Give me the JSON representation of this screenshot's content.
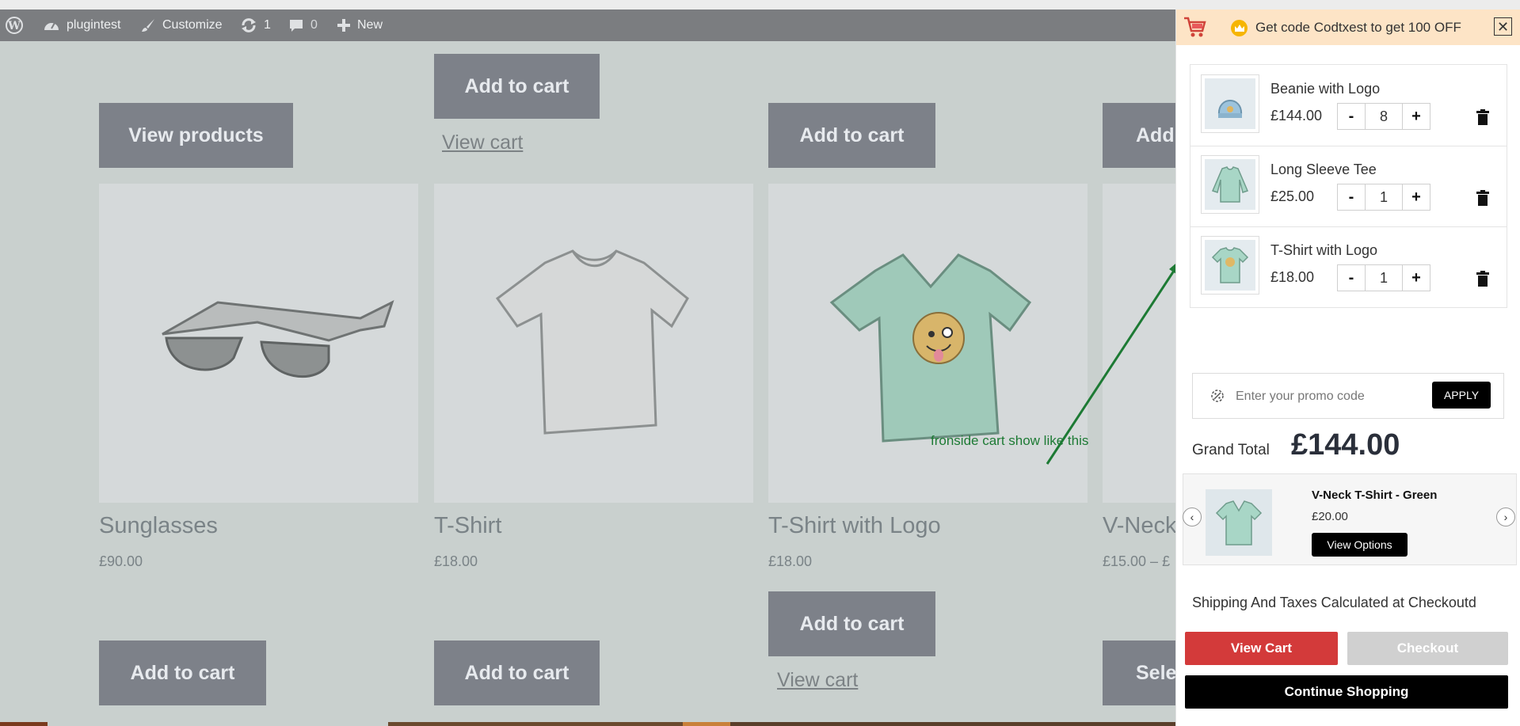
{
  "admin_bar": {
    "site_name": "plugintest",
    "customize": "Customize",
    "updates_count": "1",
    "comments_count": "0",
    "new_label": "New"
  },
  "shop": {
    "top_buttons": {
      "view_products": "View products",
      "add_to_cart": "Add to cart",
      "view_cart": "View cart"
    },
    "products": [
      {
        "name": "Sunglasses",
        "price": "£90.00",
        "button": "Add to cart"
      },
      {
        "name": "T-Shirt",
        "price": "£18.00",
        "button": "Add to cart"
      },
      {
        "name": "T-Shirt with Logo",
        "price": "£18.00",
        "button": "Add to cart",
        "link": "View cart"
      },
      {
        "name": "V-Neck",
        "price": "£15.00 – £",
        "button": "Sele"
      }
    ],
    "partial_top_button_4": "Add"
  },
  "annotation": {
    "text": "fronside cart show like this",
    "color": "#1d7a34"
  },
  "cart": {
    "notice": "Get code Codtxest to get 100 OFF",
    "close_symbol": "✕",
    "items": [
      {
        "name": "Beanie with Logo",
        "price": "£144.00",
        "qty": "8",
        "minus": "-",
        "plus": "+",
        "icon": "beanie-thumbnail"
      },
      {
        "name": "Long Sleeve Tee",
        "price": "£25.00",
        "qty": "1",
        "minus": "-",
        "plus": "+",
        "icon": "long-sleeve-thumbnail"
      },
      {
        "name": "T-Shirt with Logo",
        "price": "£18.00",
        "qty": "1",
        "minus": "-",
        "plus": "+",
        "icon": "tshirt-logo-thumbnail"
      }
    ],
    "promo": {
      "placeholder": "Enter your promo code",
      "apply": "APPLY"
    },
    "grand_total_label": "Grand Total",
    "grand_total_value": "£144.00",
    "upsell": {
      "name": "V-Neck T-Shirt - Green",
      "price": "£20.00",
      "button": "View Options",
      "prev": "‹",
      "next": "›"
    },
    "shipping_note": "Shipping And Taxes Calculated at Checkoutd",
    "view_cart": "View Cart",
    "checkout": "Checkout",
    "continue": "Continue Shopping",
    "colors": {
      "view_cart": "#d33a3a",
      "checkout_disabled": "#d0d0d0",
      "notice_bg": "#fde4c6"
    }
  }
}
